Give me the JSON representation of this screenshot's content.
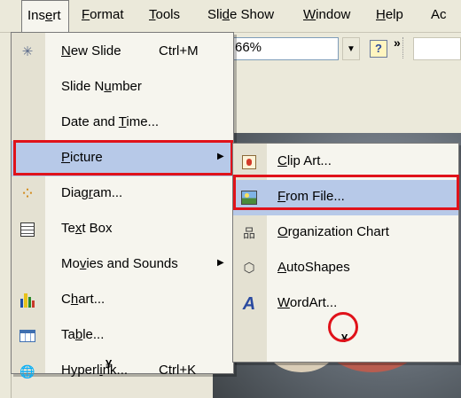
{
  "menubar": {
    "items": [
      {
        "label": "Insert",
        "mnemonic_index": 2
      },
      {
        "label": "Format",
        "mnemonic_index": 1
      },
      {
        "label": "Tools",
        "mnemonic_index": 0
      },
      {
        "label": "Slide Show",
        "mnemonic_index": 3
      },
      {
        "label": "Window",
        "mnemonic_index": 0
      },
      {
        "label": "Help",
        "mnemonic_index": 0
      },
      {
        "label": "Ac",
        "mnemonic_index": -1
      }
    ]
  },
  "toolbar": {
    "zoom_value": "66%",
    "more_label": "»"
  },
  "insert_menu": {
    "items": [
      {
        "icon": "new-slide-icon",
        "pre": "",
        "u": "N",
        "post": "ew Slide",
        "shortcut": "Ctrl+M"
      },
      {
        "icon": "",
        "pre": "Slide N",
        "u": "u",
        "post": "mber",
        "shortcut": ""
      },
      {
        "icon": "",
        "pre": "Date and ",
        "u": "T",
        "post": "ime...",
        "shortcut": ""
      },
      {
        "icon": "",
        "pre": "",
        "u": "P",
        "post": "icture",
        "shortcut": "",
        "submenu": true
      },
      {
        "icon": "diagram-icon",
        "pre": "Diag",
        "u": "r",
        "post": "am...",
        "shortcut": ""
      },
      {
        "icon": "text-box-icon",
        "pre": "Te",
        "u": "x",
        "post": "t Box",
        "shortcut": ""
      },
      {
        "icon": "",
        "pre": "Mo",
        "u": "v",
        "post": "ies and Sounds",
        "shortcut": "",
        "submenu": true
      },
      {
        "icon": "chart-icon",
        "pre": "C",
        "u": "h",
        "post": "art...",
        "shortcut": ""
      },
      {
        "icon": "table-icon",
        "pre": "Ta",
        "u": "b",
        "post": "le...",
        "shortcut": ""
      },
      {
        "icon": "hyperlink-icon",
        "pre": "Hyperl",
        "u": "i",
        "post": "nk...",
        "shortcut": "Ctrl+K"
      }
    ],
    "expand_label": "¥"
  },
  "picture_submenu": {
    "items": [
      {
        "icon": "clip-art-icon",
        "pre": "",
        "u": "C",
        "post": "lip Art..."
      },
      {
        "icon": "from-file-icon",
        "pre": "",
        "u": "F",
        "post": "rom File..."
      },
      {
        "icon": "organization-chart-icon",
        "pre": "",
        "u": "O",
        "post": "rganization Chart"
      },
      {
        "icon": "autoshapes-icon",
        "pre": "",
        "u": "A",
        "post": "utoShapes"
      },
      {
        "icon": "wordart-icon",
        "pre": "",
        "u": "W",
        "post": "ordArt..."
      }
    ],
    "expand_label": "¥"
  },
  "colors": {
    "highlight": "#b7c9e8",
    "annotation_red": "#e0121a",
    "menu_bg": "#f6f5ee",
    "chrome_bg": "#ebe9da"
  }
}
